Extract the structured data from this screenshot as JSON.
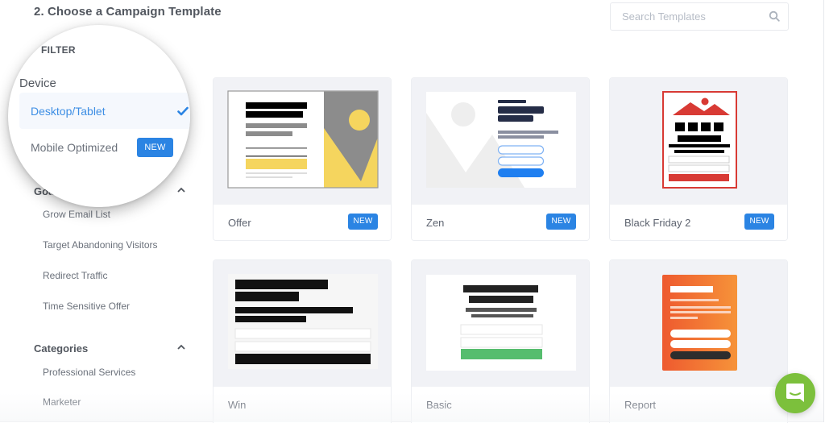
{
  "header": {
    "title": "2. Choose a Campaign Template"
  },
  "search": {
    "placeholder": "Search Templates",
    "value": ""
  },
  "sidebar": {
    "filter_label": "FILTER",
    "device": {
      "label": "Device",
      "options": [
        {
          "label": "Desktop/Tablet",
          "selected": true
        },
        {
          "label": "Mobile Optimized",
          "badge": "NEW",
          "selected": false
        }
      ]
    },
    "goals": {
      "label": "Goals",
      "expanded": true,
      "items": [
        "Grow Email List",
        "Target Abandoning Visitors",
        "Redirect Traffic",
        "Time Sensitive Offer"
      ]
    },
    "categories": {
      "label": "Categories",
      "expanded": true,
      "items": [
        "Professional Services",
        "Marketer"
      ]
    }
  },
  "templates": [
    {
      "name": "Offer",
      "badge": "NEW"
    },
    {
      "name": "Zen",
      "badge": "NEW"
    },
    {
      "name": "Black Friday 2",
      "badge": "NEW"
    },
    {
      "name": "Win"
    },
    {
      "name": "Basic"
    },
    {
      "name": "Report"
    }
  ],
  "colors": {
    "accent": "#2b84e3",
    "selected_text": "#3d8ee4",
    "chat": "#7cc03c",
    "offer_yellow": "#f5d55e",
    "bf_red": "#d83a34",
    "basic_green": "#56bd6e",
    "report_orange_start": "#ee5a2f",
    "report_orange_end": "#f69339"
  }
}
